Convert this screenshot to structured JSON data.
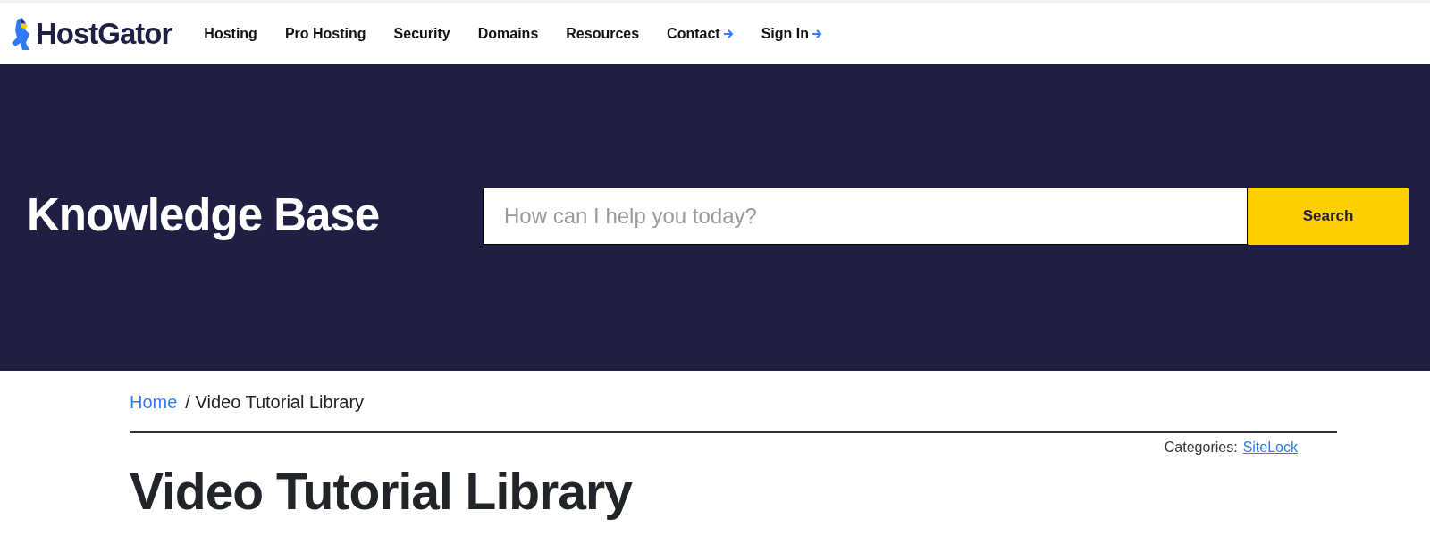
{
  "header": {
    "logo": "HostGator",
    "nav": [
      {
        "label": "Hosting",
        "has_arrow": false
      },
      {
        "label": "Pro Hosting",
        "has_arrow": false
      },
      {
        "label": "Security",
        "has_arrow": false
      },
      {
        "label": "Domains",
        "has_arrow": false
      },
      {
        "label": "Resources",
        "has_arrow": false
      },
      {
        "label": "Contact",
        "has_arrow": true
      },
      {
        "label": "Sign In",
        "has_arrow": true
      }
    ]
  },
  "hero": {
    "title": "Knowledge Base",
    "search": {
      "placeholder": "How can I help you today?",
      "button": "Search"
    }
  },
  "breadcrumb": {
    "home": "Home",
    "current": "/ Video Tutorial Library"
  },
  "categories": {
    "label": "Categories:",
    "link": "SiteLock"
  },
  "page_title": "Video Tutorial Library"
}
